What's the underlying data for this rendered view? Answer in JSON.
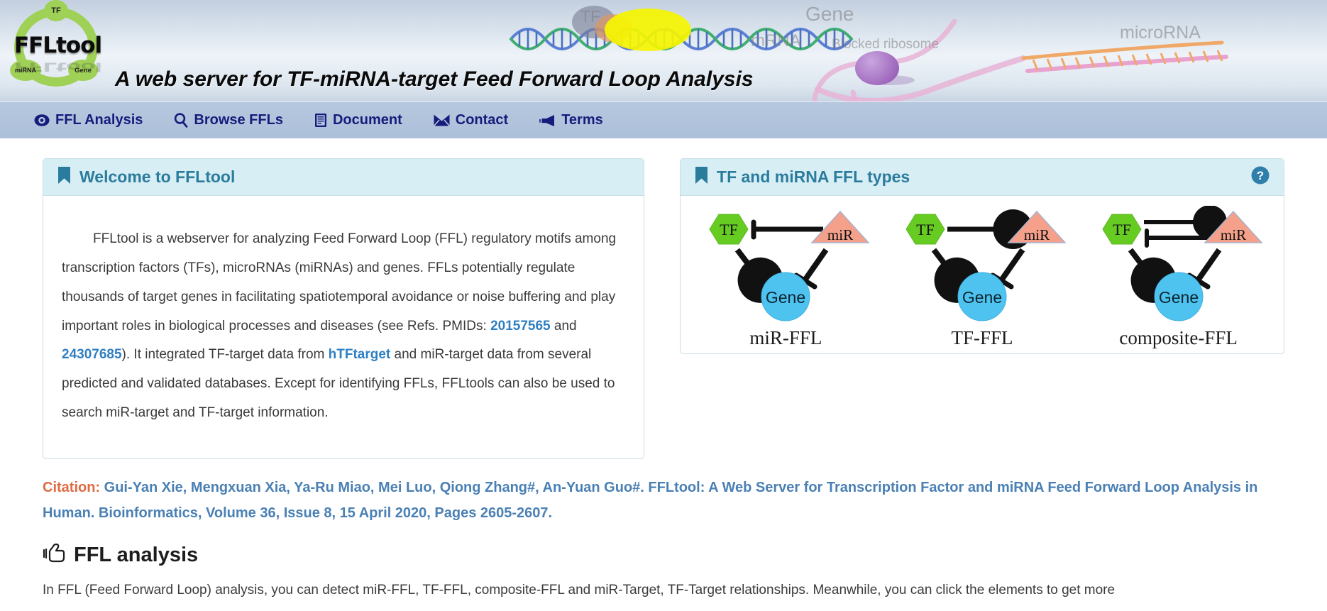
{
  "banner": {
    "logo": {
      "text": "FFLtool",
      "node_tf": "TF",
      "node_mirna": "miRNA",
      "node_gene": "Gene"
    },
    "title": "A web server for TF-miRNA-target Feed Forward Loop Analysis",
    "art_labels": {
      "tf": "TF",
      "gene": "Gene",
      "mrna": "mRNA",
      "blocked_ribosome": "Blocked ribosome",
      "microrna": "microRNA"
    }
  },
  "nav": {
    "items": [
      {
        "label": "FFL Analysis",
        "icon": "eye-icon"
      },
      {
        "label": "Browse FFLs",
        "icon": "search-icon"
      },
      {
        "label": "Document",
        "icon": "document-icon"
      },
      {
        "label": "Contact",
        "icon": "envelope-icon"
      },
      {
        "label": "Terms",
        "icon": "megaphone-icon"
      }
    ]
  },
  "welcome_panel": {
    "title": "Welcome to FFLtool",
    "icon": "bookmark-icon",
    "text_parts": {
      "p1": "FFLtool is a webserver for analyzing Feed Forward Loop (FFL) regulatory motifs among transcription factors (TFs), microRNAs (miRNAs) and genes. FFLs potentially regulate thousands of target genes in facilitating spatiotemporal avoidance or noise buffering and play important roles in biological processes and diseases (see Refs. PMIDs: ",
      "link_pmid1": "20157565",
      "p2": " and ",
      "link_pmid2": "24307685",
      "p3": "). It integrated TF-target data from ",
      "link_htftarget": "hTFtarget",
      "p4": " and miR-target data from several predicted and validated databases. Except for identifying FFLs, FFLtools can also be used to search miR-target and TF-target information."
    }
  },
  "ffl_types_panel": {
    "title": "TF and miRNA FFL types",
    "icon": "bookmark-icon",
    "help_icon": "question-circle-icon",
    "diagrams": [
      {
        "label": "miR-FFL",
        "nodes": {
          "tf": "TF",
          "mir": "miR",
          "gene": "Gene"
        },
        "edges": [
          {
            "from": "miR",
            "to": "TF",
            "type": "repression"
          },
          {
            "from": "TF",
            "to": "Gene",
            "type": "regulation"
          },
          {
            "from": "miR",
            "to": "Gene",
            "type": "repression"
          }
        ]
      },
      {
        "label": "TF-FFL",
        "nodes": {
          "tf": "TF",
          "mir": "miR",
          "gene": "Gene"
        },
        "edges": [
          {
            "from": "TF",
            "to": "miR",
            "type": "regulation"
          },
          {
            "from": "TF",
            "to": "Gene",
            "type": "regulation"
          },
          {
            "from": "miR",
            "to": "Gene",
            "type": "repression"
          }
        ]
      },
      {
        "label": "composite-FFL",
        "nodes": {
          "tf": "TF",
          "mir": "miR",
          "gene": "Gene"
        },
        "edges": [
          {
            "from": "TF",
            "to": "miR",
            "type": "regulation"
          },
          {
            "from": "miR",
            "to": "TF",
            "type": "repression"
          },
          {
            "from": "TF",
            "to": "Gene",
            "type": "regulation"
          },
          {
            "from": "miR",
            "to": "Gene",
            "type": "repression"
          }
        ]
      }
    ]
  },
  "citation": {
    "label": "Citation:",
    "text": "Gui-Yan Xie, Mengxuan Xia, Ya-Ru Miao, Mei Luo, Qiong Zhang#, An-Yuan Guo#. FFLtool: A Web Server for Transcription Factor and miRNA Feed Forward Loop Analysis in Human. Bioinformatics, Volume 36, Issue 8, 15 April 2020, Pages 2605-2607."
  },
  "ffl_analysis": {
    "heading": "FFL analysis",
    "heading_icon": "pointing-hand-icon",
    "body": "In FFL (Feed Forward Loop) analysis, you can detect miR-FFL, TF-FFL, composite-FFL and miR-Target, TF-Target relationships. Meanwhile, you can click the elements to get more"
  },
  "colors": {
    "brand_blue": "#2b7c9c",
    "nav_text": "#151c7c",
    "nav_bg": "#b2c5dd",
    "panel_head_bg": "#d7eef5",
    "panel_border": "#c8dde6",
    "citation_blue": "#4a80b4",
    "citation_label": "#e06a42",
    "link_blue": "#2e7fc1",
    "tf_green": "#66cc22",
    "mir_salmon": "#f4a08a",
    "gene_blue": "#4fc3f0",
    "logo_green": "#9fd157"
  }
}
